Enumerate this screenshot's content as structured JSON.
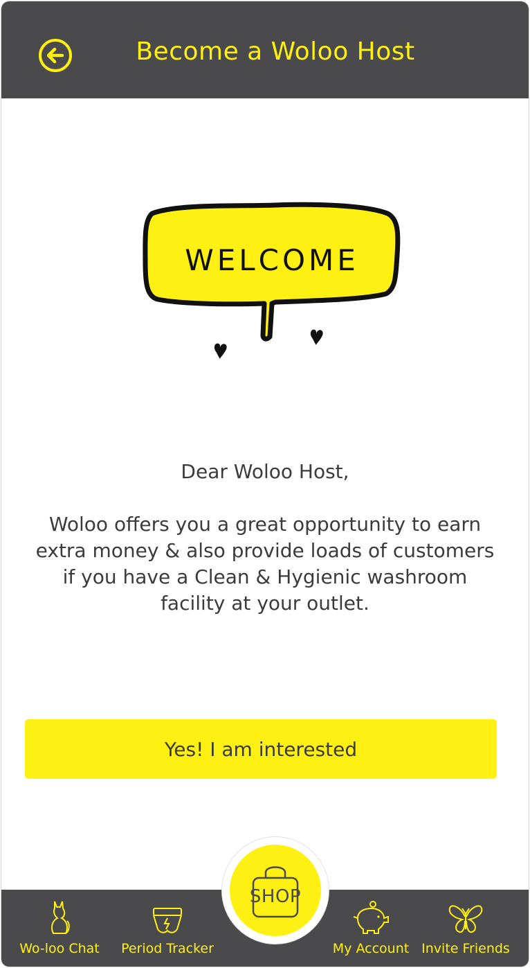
{
  "header": {
    "title": "Become a Woloo Host",
    "back_icon": "arrow-left-circle-icon"
  },
  "illustration": {
    "text": "WELCOME",
    "icon": "speech-bubble-icon"
  },
  "message": {
    "greeting": "Dear Woloo Host,",
    "body": "Woloo offers you a great opportunity to earn extra money & also provide loads of customers if you have a Clean & Hygienic washroom facility at your outlet."
  },
  "cta": {
    "label": "Yes! I am interested"
  },
  "shop": {
    "label": "SHOP",
    "icon": "shopping-bag-icon"
  },
  "bottom_nav": {
    "items": [
      {
        "label": "Wo-loo Chat",
        "icon": "cat-icon"
      },
      {
        "label": "Period Tracker",
        "icon": "underwear-icon"
      },
      {
        "label": "My Account",
        "icon": "piggy-bank-icon"
      },
      {
        "label": "Invite Friends",
        "icon": "butterfly-icon"
      }
    ]
  },
  "colors": {
    "brand_yellow": "#fff013",
    "dark_gray": "#4a4a4c",
    "text": "#3b3b3d"
  }
}
